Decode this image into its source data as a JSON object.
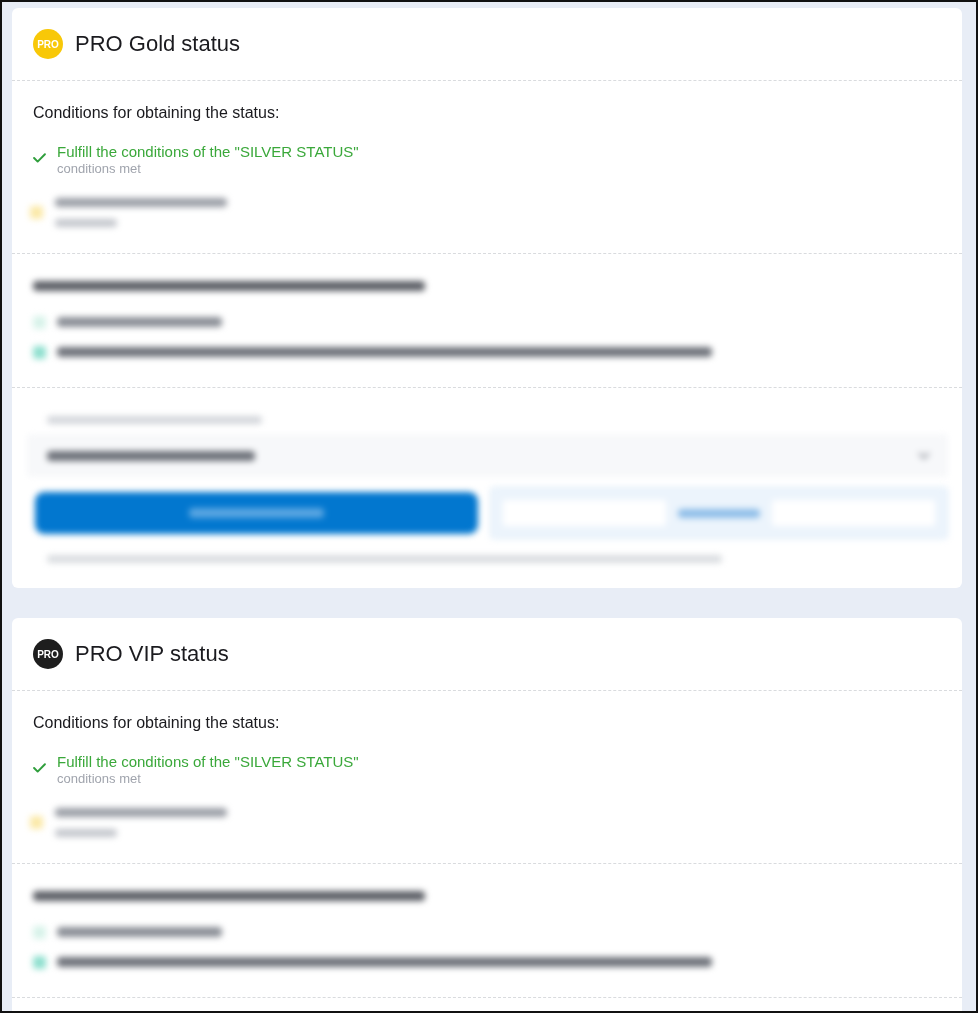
{
  "statuses": [
    {
      "badge": "PRO",
      "color": "#f8c808",
      "title": "PRO Gold status",
      "sections": [
        {
          "kind": "conditions",
          "heading": "Conditions for obtaining the status:",
          "items": [
            {
              "kind": "requirement",
              "title": "Fulfill the conditions of the \"SILVER STATUS\"",
              "note": "conditions met",
              "met": true
            },
            {
              "kind": "blurred"
            }
          ]
        },
        {
          "kind": "blurred_list"
        },
        {
          "kind": "blurred_form"
        }
      ]
    },
    {
      "badge": "PRO",
      "color": "#1e1e1e",
      "title": "PRO VIP status",
      "sections": [
        {
          "kind": "conditions",
          "heading": "Conditions for obtaining the status:",
          "items": [
            {
              "kind": "requirement",
              "title": "Fulfill the conditions of the \"SILVER STATUS\"",
              "note": "conditions met",
              "met": true
            },
            {
              "kind": "blurred"
            }
          ]
        },
        {
          "kind": "blurred_list"
        }
      ]
    }
  ]
}
